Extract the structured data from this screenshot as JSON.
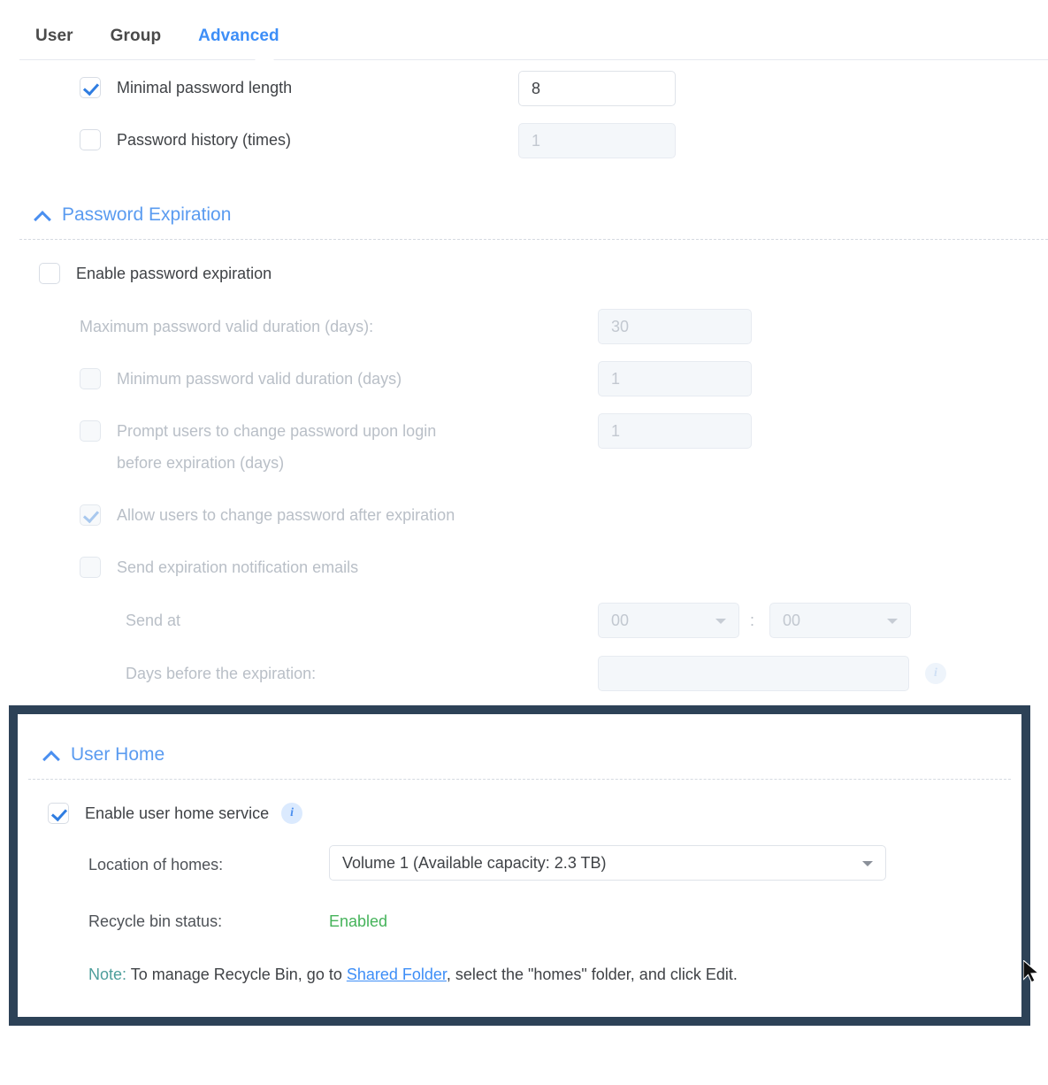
{
  "tabs": [
    {
      "label": "User",
      "active": false
    },
    {
      "label": "Group",
      "active": false
    },
    {
      "label": "Advanced",
      "active": true
    }
  ],
  "password_strength": {
    "rows": [
      {
        "label": "Minimal password length",
        "checked": true,
        "disabled": false,
        "value": "8"
      },
      {
        "label": "Password history (times)",
        "checked": false,
        "disabled": false,
        "value": "1",
        "value_disabled": true
      }
    ]
  },
  "password_expiration": {
    "title": "Password Expiration",
    "enable_label": "Enable password expiration",
    "enable_checked": false,
    "rows": [
      {
        "label": "Maximum password valid duration (days):",
        "has_checkbox": false,
        "checked": false,
        "value": "30"
      },
      {
        "label": "Minimum password valid duration (days)",
        "has_checkbox": true,
        "checked": false,
        "value": "1"
      },
      {
        "label": "Prompt users to change password upon login",
        "label2": "before expiration (days)",
        "has_checkbox": true,
        "checked": false,
        "value": "1"
      },
      {
        "label": "Allow users to change password after expiration",
        "has_checkbox": true,
        "checked": true
      },
      {
        "label": "Send expiration notification emails",
        "has_checkbox": true,
        "checked": false
      }
    ],
    "send_at": {
      "label": "Send at",
      "hour": "00",
      "separator": ":",
      "minute": "00"
    },
    "days_before": {
      "label": "Days before the expiration:",
      "value": "",
      "info_icon": "info-icon"
    }
  },
  "user_home": {
    "title": "User Home",
    "enable_label": "Enable user home service",
    "enable_checked": true,
    "enable_info_icon": "info-icon",
    "location_label": "Location of homes:",
    "location_value": "Volume 1 (Available capacity:  2.3 TB)",
    "recycle_label": "Recycle bin status:",
    "recycle_value": "Enabled",
    "note_prefix": "Note:",
    "note_part1": " To manage Recycle Bin, go to ",
    "note_link": "Shared Folder",
    "note_part2": ", select the \"homes\" folder, and click Edit."
  },
  "colors": {
    "accent_blue": "#3d8ef7",
    "section_blue": "#5a9bf0",
    "highlight_border": "#2d4257",
    "status_green": "#45b35a",
    "note_teal": "#4d9e9b",
    "disabled_text": "#b9bfc7"
  }
}
